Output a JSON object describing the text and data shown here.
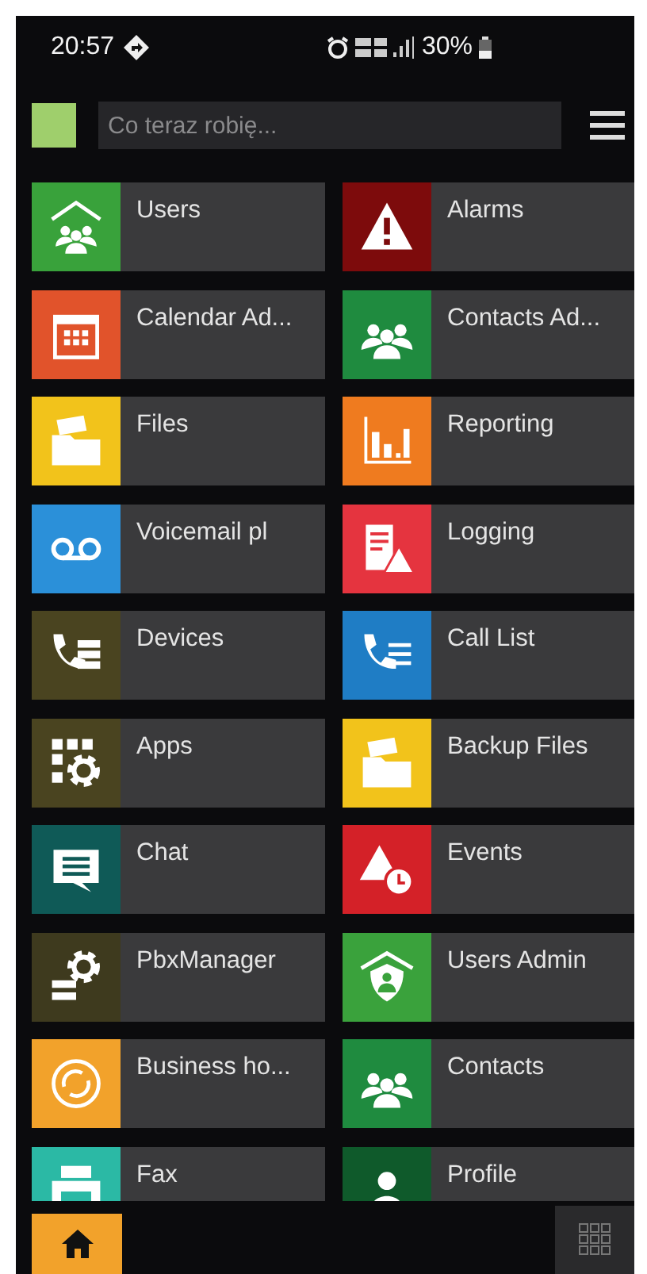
{
  "status_bar": {
    "time": "20:57",
    "battery": "30%"
  },
  "header": {
    "status": {
      "color": "#9fcf6c"
    },
    "search": {
      "placeholder": "Co teraz robię..."
    }
  },
  "tiles": [
    {
      "label": "Users",
      "kind": "users",
      "color": "#39a23b"
    },
    {
      "label": "Alarms",
      "kind": "warning",
      "color": "#7d0b0c"
    },
    {
      "label": "Calendar Ad...",
      "kind": "calendar",
      "color": "#e1532b"
    },
    {
      "label": "Contacts Ad...",
      "kind": "people",
      "color": "#1f8b3f"
    },
    {
      "label": "Files",
      "kind": "folder",
      "color": "#f2c31b"
    },
    {
      "label": "Reporting",
      "kind": "chart",
      "color": "#ef7b1f"
    },
    {
      "label": "Voicemail pl",
      "kind": "voicemail",
      "color": "#2b90d9"
    },
    {
      "label": "Logging",
      "kind": "log",
      "color": "#e5343f"
    },
    {
      "label": "Devices",
      "kind": "phone-server",
      "color": "#4a4420"
    },
    {
      "label": "Call List",
      "kind": "phone-list",
      "color": "#1f7dc5"
    },
    {
      "label": "Apps",
      "kind": "apps",
      "color": "#4a4420"
    },
    {
      "label": "Backup Files",
      "kind": "folder",
      "color": "#f2c31b"
    },
    {
      "label": "Chat",
      "kind": "chat",
      "color": "#0f5a57"
    },
    {
      "label": "Events",
      "kind": "event",
      "color": "#d42128"
    },
    {
      "label": "PbxManager",
      "kind": "server-gear",
      "color": "#3e3a1e"
    },
    {
      "label": "Users Admin",
      "kind": "shield",
      "color": "#3aa23c"
    },
    {
      "label": "Business ho...",
      "kind": "hours",
      "color": "#f2a22b"
    },
    {
      "label": "Contacts",
      "kind": "people",
      "color": "#1f8b3f"
    },
    {
      "label": "Fax",
      "kind": "fax",
      "color": "#2bb9a5"
    },
    {
      "label": "Profile",
      "kind": "person",
      "color": "#0f5a2b"
    }
  ],
  "nav": [
    {
      "kind": "home",
      "selected": true
    },
    {
      "kind": "grid",
      "selected": false
    }
  ]
}
